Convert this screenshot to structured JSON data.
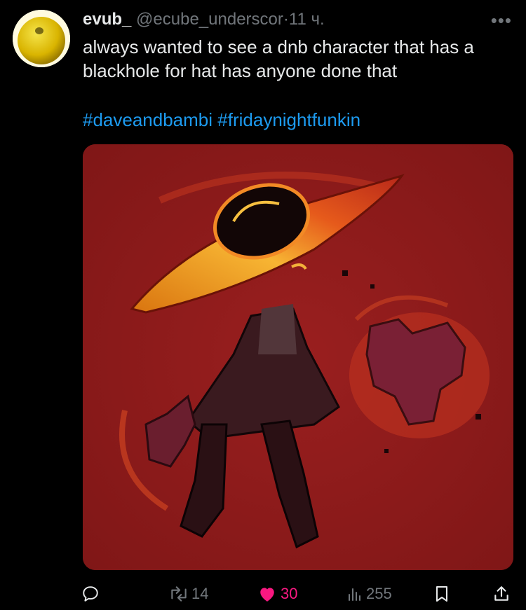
{
  "tweet": {
    "display_name": "evub_",
    "handle": "@ecube_underscor",
    "separator": "·",
    "time": "11 ч.",
    "more_label": "•••",
    "text": "always wanted to see a dnb character that has a blackhole for hat has anyone done that",
    "hashtags": [
      "#daveandbambi",
      "#fridaynightfunkin"
    ]
  },
  "actions": {
    "replies": "",
    "retweets": "14",
    "likes": "30",
    "views": "255"
  },
  "colors": {
    "background": "#000000",
    "text": "#e7e9ea",
    "muted": "#71767b",
    "link": "#1d9bf0",
    "like": "#f91880",
    "media_bg": "#8d1a1a"
  },
  "icons": {
    "reply": "speech-bubble-icon",
    "retweet": "retweet-arrows-icon",
    "like": "heart-filled-icon",
    "views": "bar-chart-icon",
    "bookmark": "bookmark-icon",
    "share": "share-upload-icon"
  }
}
